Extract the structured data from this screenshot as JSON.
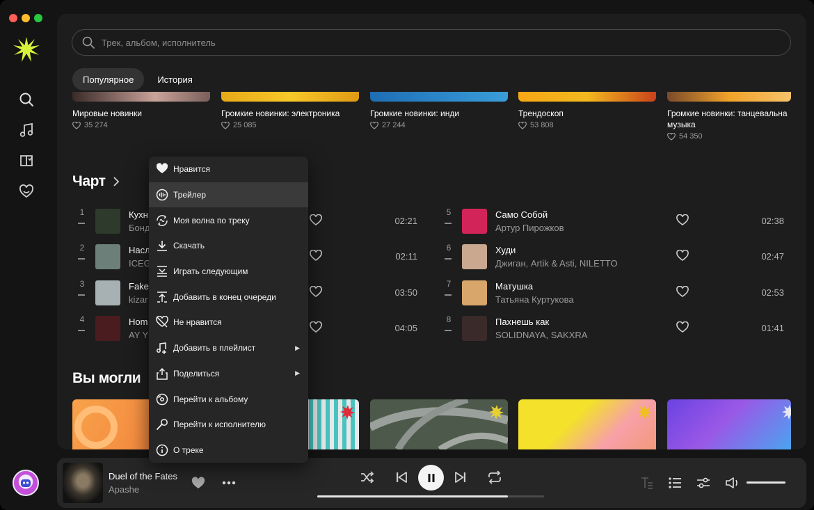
{
  "search": {
    "placeholder": "Трек, альбом, исполнитель"
  },
  "tabs": [
    {
      "label": "Популярное",
      "active": true
    },
    {
      "label": "История",
      "active": false
    }
  ],
  "playlists": [
    {
      "title": "Мировые новинки",
      "likes": "35 274",
      "color": "#c9a39a"
    },
    {
      "title": "Громкие новинки: электроника",
      "likes": "25 085",
      "color": "#f0b41c"
    },
    {
      "title": "Громкие новинки: инди",
      "likes": "27 244",
      "color": "#2b86c8"
    },
    {
      "title": "Трендоскоп",
      "likes": "53 808",
      "color": "#f6a614"
    },
    {
      "title": "Громкие новинки: танцевальна музыка",
      "likes": "54 350",
      "color": "#f0a22a"
    }
  ],
  "chart": {
    "title": "Чарт",
    "tracks": [
      {
        "rank": "1",
        "title": "Кухн",
        "artist": "Бонд",
        "duration": "02:21",
        "thumb": "#2d3a2c"
      },
      {
        "rank": "2",
        "title": "Насл",
        "artist": "ICEG",
        "duration": "02:11",
        "thumb": "#6d7f79"
      },
      {
        "rank": "3",
        "title": "Fake",
        "artist": "kizar",
        "duration": "03:50",
        "thumb": "#a7b1b3"
      },
      {
        "rank": "4",
        "title": "Hom",
        "artist": "AY YO",
        "duration": "04:05",
        "thumb": "#4a1c1f"
      },
      {
        "rank": "5",
        "title": "Само Собой",
        "artist": "Артур Пирожков",
        "duration": "02:38",
        "thumb": "#d3245a"
      },
      {
        "rank": "6",
        "title": "Худи",
        "artist": "Джиган, Artik & Asti, NILETTO",
        "duration": "02:47",
        "thumb": "#c9a88f"
      },
      {
        "rank": "7",
        "title": "Матушка",
        "artist": "Татьяна Куртукова",
        "duration": "02:53",
        "thumb": "#d8a66a"
      },
      {
        "rank": "8",
        "title": "Пахнешь как",
        "artist": "SOLIDNAYA, SAKXRA",
        "duration": "01:41",
        "thumb": "#3a2a2a"
      }
    ]
  },
  "might_like": {
    "title": "Вы могли"
  },
  "context_menu": {
    "items": [
      {
        "label": "Нравится",
        "icon": "heart-filled-icon",
        "submenu": false
      },
      {
        "label": "Трейлер",
        "icon": "trailer-icon",
        "submenu": false,
        "hover": true
      },
      {
        "label": "Моя волна по треку",
        "icon": "wave-icon",
        "submenu": false
      },
      {
        "label": "Скачать",
        "icon": "download-icon",
        "submenu": false
      },
      {
        "label": "Играть следующим",
        "icon": "play-next-icon",
        "submenu": false
      },
      {
        "label": "Добавить в конец очереди",
        "icon": "queue-end-icon",
        "submenu": false
      },
      {
        "label": "Не нравится",
        "icon": "dislike-icon",
        "submenu": false
      },
      {
        "label": "Добавить в плейлист",
        "icon": "add-playlist-icon",
        "submenu": true
      },
      {
        "label": "Поделиться",
        "icon": "share-icon",
        "submenu": true
      },
      {
        "label": "Перейти к альбому",
        "icon": "album-icon",
        "submenu": false
      },
      {
        "label": "Перейти к исполнителю",
        "icon": "artist-icon",
        "submenu": false
      },
      {
        "label": "О треке",
        "icon": "info-icon",
        "submenu": false
      }
    ]
  },
  "player": {
    "title": "Duel of the Fates",
    "artist": "Apashe",
    "progress": 0.84,
    "volume": 1.0
  },
  "colors": {
    "accent": "#f4f4f4",
    "logo": "#d7f23a"
  }
}
